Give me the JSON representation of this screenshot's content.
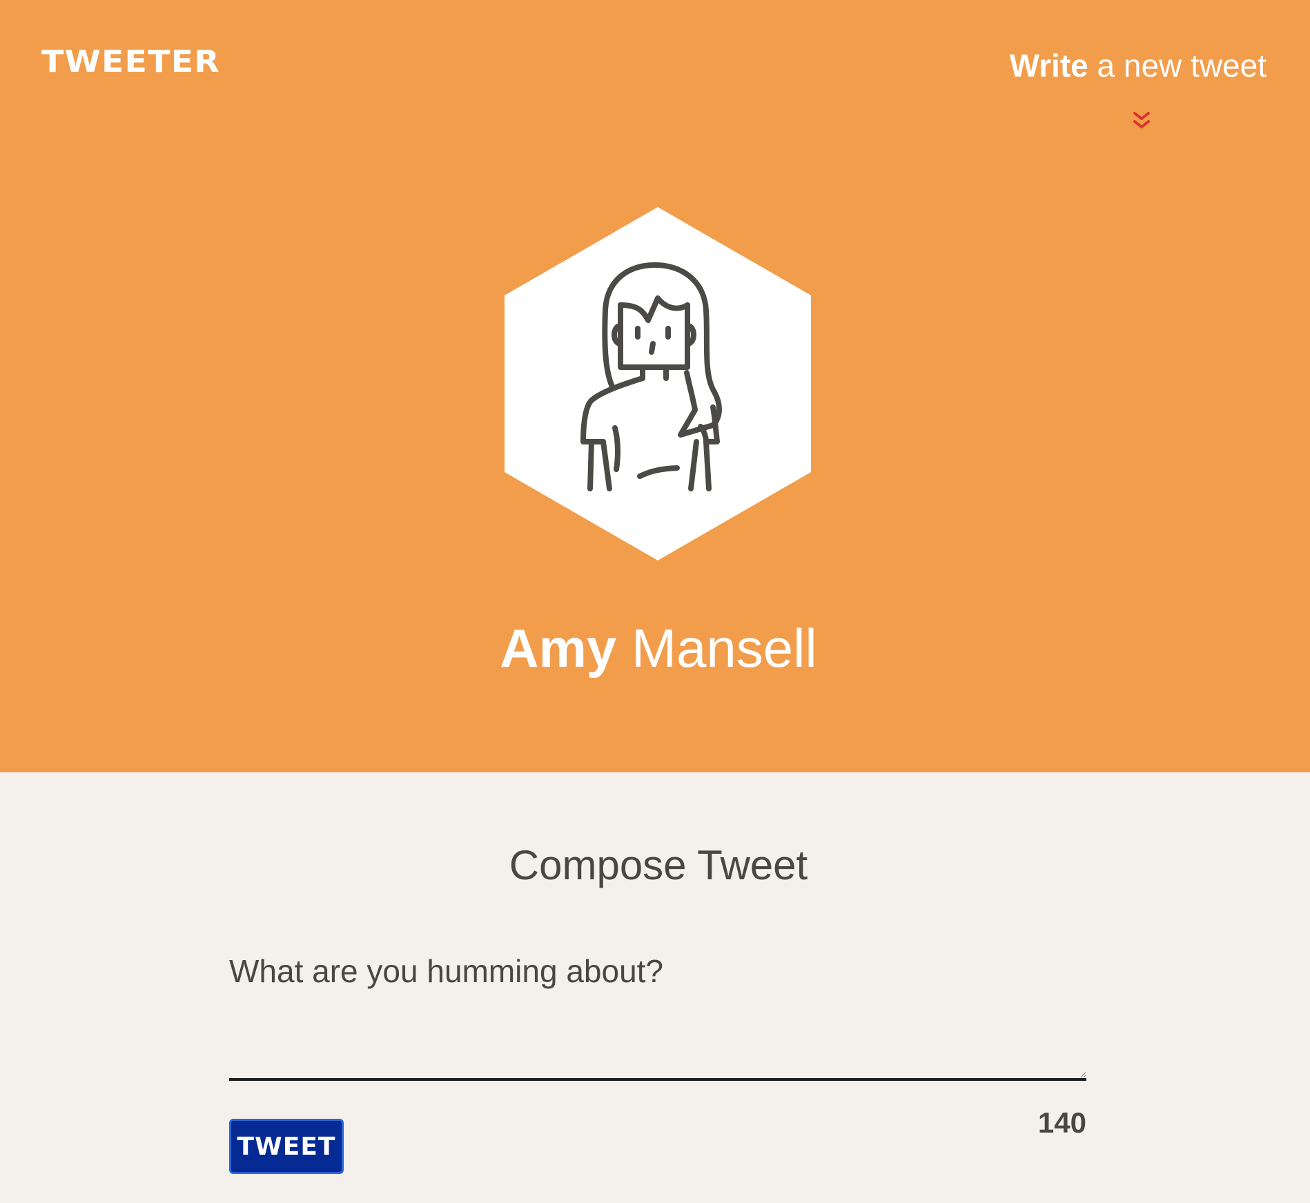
{
  "header": {
    "brand": "TWEETER",
    "write_link": {
      "strong": "Write",
      "rest": "a new tweet"
    },
    "expand_icon": "chevron-double-down-icon"
  },
  "profile": {
    "avatar_icon": "woman-avatar-icon",
    "first_name": "Amy",
    "last_name": "Mansell"
  },
  "compose": {
    "title": "Compose Tweet",
    "placeholder": "What are you humming about?",
    "value": "",
    "button_label": "TWEET",
    "char_count": "140"
  },
  "colors": {
    "header_bg": "#f29d4b",
    "page_bg": "#f4f1ed",
    "button_bg": "#052a93",
    "chevron": "#d9352b",
    "text": "#4a4641"
  }
}
